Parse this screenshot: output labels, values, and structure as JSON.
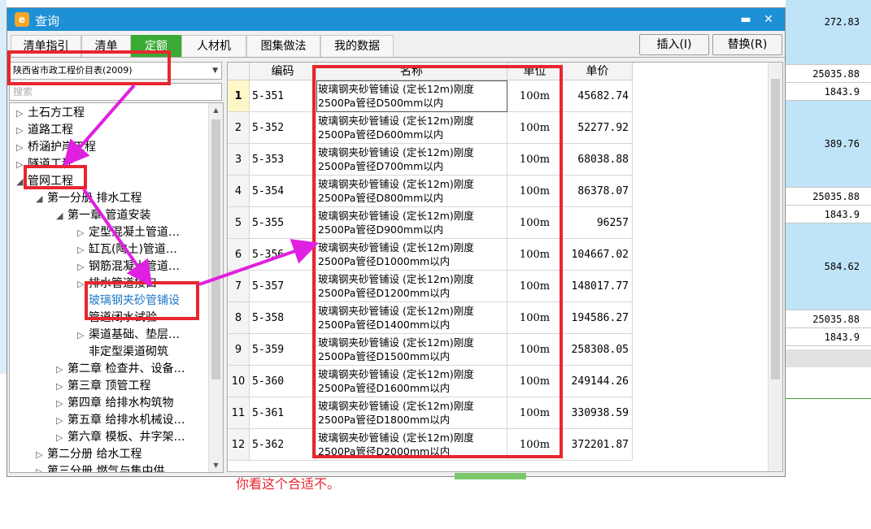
{
  "background": {
    "right_values": [
      "272.83",
      "25035.88",
      "1843.9",
      "389.76",
      "25035.88",
      "1843.9",
      "584.62",
      "25035.88",
      "1843.9"
    ]
  },
  "dialog": {
    "title": "查询",
    "title_color": "#1e90d6",
    "minimize_icon": "minimize-icon",
    "close_icon": "close-icon",
    "tabs": [
      "清单指引",
      "清单",
      "定额",
      "人材机",
      "图集做法",
      "我的数据"
    ],
    "active_tab": "定额",
    "active_tab_color": "#3aaa35",
    "insert_button": "插入(I)",
    "replace_button": "替换(R)"
  },
  "left_panel": {
    "library": "陕西省市政工程价目表(2009)",
    "search_placeholder": "搜索",
    "tree": [
      {
        "label": "土石方工程",
        "arrow": "▷"
      },
      {
        "label": "道路工程",
        "arrow": "▷"
      },
      {
        "label": "桥涵护岸工程",
        "arrow": "▷"
      },
      {
        "label": "隧道工程",
        "arrow": "▷"
      },
      {
        "label": "管网工程",
        "arrow": "◢"
      },
      {
        "label": "第一分册 排水工程",
        "arrow": "◢"
      },
      {
        "label": "第一章 管道安装",
        "arrow": "◢"
      },
      {
        "label": "定型混凝土管道…",
        "arrow": "▷"
      },
      {
        "label": "缸瓦(陶土)管道…",
        "arrow": "▷"
      },
      {
        "label": "钢筋混凝土管道…",
        "arrow": "▷"
      },
      {
        "label": "排水管道接口",
        "arrow": "▷"
      },
      {
        "label": "玻璃钢夹砂管铺设",
        "arrow": ""
      },
      {
        "label": "管道闭水试验",
        "arrow": ""
      },
      {
        "label": "渠道基础、垫层…",
        "arrow": "▷"
      },
      {
        "label": "非定型渠道砌筑",
        "arrow": ""
      },
      {
        "label": "第二章 检查井、设备…",
        "arrow": "▷"
      },
      {
        "label": "第三章 顶管工程",
        "arrow": "▷"
      },
      {
        "label": "第四章 给排水构筑物",
        "arrow": "▷"
      },
      {
        "label": "第五章 给排水机械设…",
        "arrow": "▷"
      },
      {
        "label": "第六章 模板、井字架…",
        "arrow": "▷"
      },
      {
        "label": "第二分册 给水工程",
        "arrow": "▷"
      },
      {
        "label": "第三分册 燃气与集中供…",
        "arrow": "▷"
      }
    ]
  },
  "grid": {
    "headers": [
      "编码",
      "名称",
      "单位",
      "单价"
    ],
    "rows": [
      {
        "idx": "1",
        "code": "5-351",
        "name1": "玻璃钢夹砂管铺设 (定长12m)刚度",
        "name2": "2500Pa管径D500mm以内",
        "unit": "100m",
        "price": "45682.74"
      },
      {
        "idx": "2",
        "code": "5-352",
        "name1": "玻璃钢夹砂管铺设 (定长12m)刚度",
        "name2": "2500Pa管径D600mm以内",
        "unit": "100m",
        "price": "52277.92"
      },
      {
        "idx": "3",
        "code": "5-353",
        "name1": "玻璃钢夹砂管铺设 (定长12m)刚度",
        "name2": "2500Pa管径D700mm以内",
        "unit": "100m",
        "price": "68038.88"
      },
      {
        "idx": "4",
        "code": "5-354",
        "name1": "玻璃钢夹砂管铺设 (定长12m)刚度",
        "name2": "2500Pa管径D800mm以内",
        "unit": "100m",
        "price": "86378.07"
      },
      {
        "idx": "5",
        "code": "5-355",
        "name1": "玻璃钢夹砂管铺设 (定长12m)刚度",
        "name2": "2500Pa管径D900mm以内",
        "unit": "100m",
        "price": "96257"
      },
      {
        "idx": "6",
        "code": "5-356",
        "name1": "玻璃钢夹砂管铺设 (定长12m)刚度",
        "name2": "2500Pa管径D1000mm以内",
        "unit": "100m",
        "price": "104667.02"
      },
      {
        "idx": "7",
        "code": "5-357",
        "name1": "玻璃钢夹砂管铺设 (定长12m)刚度",
        "name2": "2500Pa管径D1200mm以内",
        "unit": "100m",
        "price": "148017.77"
      },
      {
        "idx": "8",
        "code": "5-358",
        "name1": "玻璃钢夹砂管铺设 (定长12m)刚度",
        "name2": "2500Pa管径D1400mm以内",
        "unit": "100m",
        "price": "194586.27"
      },
      {
        "idx": "9",
        "code": "5-359",
        "name1": "玻璃钢夹砂管铺设 (定长12m)刚度",
        "name2": "2500Pa管径D1500mm以内",
        "unit": "100m",
        "price": "258308.05"
      },
      {
        "idx": "10",
        "code": "5-360",
        "name1": "玻璃钢夹砂管铺设 (定长12m)刚度",
        "name2": "2500Pa管径D1600mm以内",
        "unit": "100m",
        "price": "249144.26"
      },
      {
        "idx": "11",
        "code": "5-361",
        "name1": "玻璃钢夹砂管铺设 (定长12m)刚度",
        "name2": "2500Pa管径D1800mm以内",
        "unit": "100m",
        "price": "330938.59"
      },
      {
        "idx": "12",
        "code": "5-362",
        "name1": "玻璃钢夹砂管铺设 (定长12m)刚度",
        "name2": "2500Pa管径D2000mm以内",
        "unit": "100m",
        "price": "372201.87"
      }
    ]
  },
  "annotation": {
    "text": "你看这个合适不。",
    "color": "#e8262f",
    "arrow_color": "#e020e0"
  }
}
